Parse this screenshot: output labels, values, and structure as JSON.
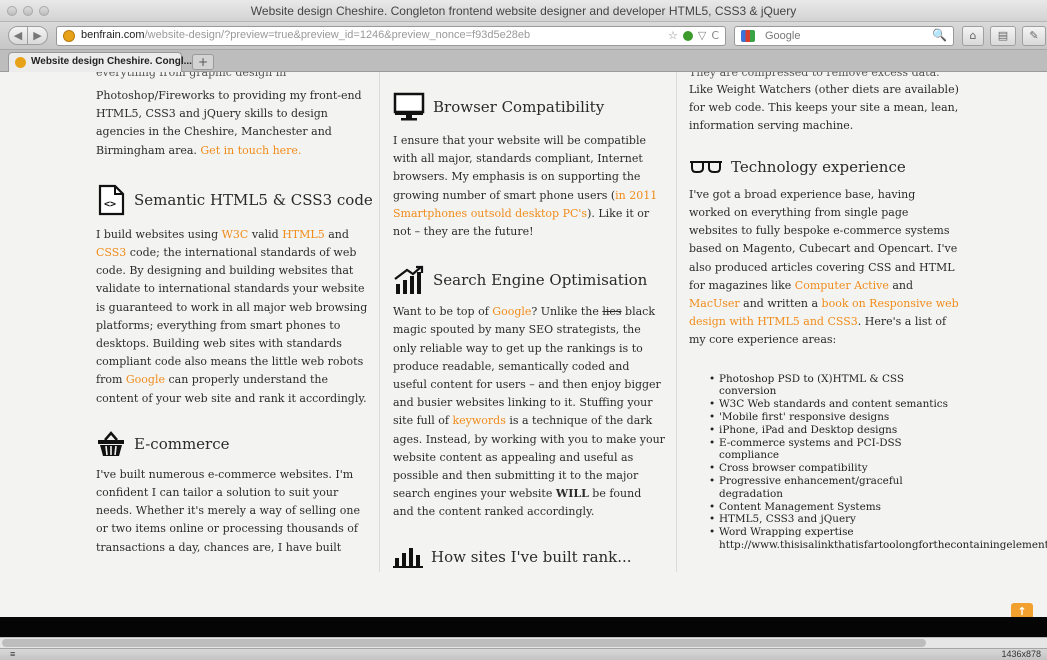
{
  "window": {
    "title": "Website design Cheshire. Congleton frontend website designer and developer HTML5, CSS3 & jQuery"
  },
  "nav": {
    "back_glyph": "◀",
    "forward_glyph": "▶",
    "url_domain": "benfrain.com",
    "url_rest": "/website-design/?preview=true&preview_id=1246&preview_nonce=f93d5e28eb",
    "url_star": "☆",
    "url_filter": "▽",
    "url_reload": "C",
    "search_placeholder": "Google",
    "search_glyph": "🔍",
    "home_glyph": "⌂",
    "bookmark_glyph": "▤",
    "more_glyph": "✎"
  },
  "tabs": [
    {
      "label": "Website design Cheshire. Congl..."
    }
  ],
  "new_tab_glyph": "+",
  "col1": {
    "cut_text": "everything from graphic design in",
    "intro": [
      {
        "t": "Photoshop/Fireworks to providing my front-end HTML5, CSS3 and jQuery skills to design agencies in the Cheshire, Manchester and Birmingham area. "
      },
      {
        "t": "Get in touch here.",
        "link": true
      }
    ],
    "semantic_heading": "Semantic HTML5 & CSS3 code",
    "semantic_body": [
      {
        "t": "I build websites using "
      },
      {
        "t": "W3C",
        "link": true
      },
      {
        "t": " valid "
      },
      {
        "t": "HTML5",
        "link": true
      },
      {
        "t": " and "
      },
      {
        "t": "CSS3",
        "link": true
      },
      {
        "t": " code; the international standards of web code. By designing and building websites that validate to international standards your website is guaranteed to work in all major web browsing platforms; everything from smart phones to desktops. Building web sites with standards compliant code also means the little web robots from "
      },
      {
        "t": "Google",
        "link": true
      },
      {
        "t": " can properly understand the content of your web site and rank it accordingly."
      }
    ],
    "ecom_heading": "E-commerce",
    "ecom_body": [
      {
        "t": "I've built numerous e-commerce websites. I'm confident I can tailor a solution to suit your needs. Whether it's merely a way of selling one or two items online or processing thousands of transactions a day, chances are, I have built"
      }
    ]
  },
  "col2": {
    "browser_heading": "Browser Compatibility",
    "browser_body": [
      {
        "t": "I ensure that your website will be compatible with all major, standards compliant, Internet browsers. My emphasis is on supporting the growing number of smart phone users ("
      },
      {
        "t": "in 2011 Smartphones outsold desktop PC's",
        "link": true
      },
      {
        "t": "). Like it or not – they are the future!"
      }
    ],
    "seo_heading": "Search Engine Optimisation",
    "seo_body": [
      {
        "t": "Want to be top of "
      },
      {
        "t": "Google",
        "link": true
      },
      {
        "t": "? Unlike the "
      },
      {
        "t": "lies",
        "strike": true
      },
      {
        "t": " black magic spouted by many SEO strategists, the only reliable way to get up the rankings is to produce readable, semantically coded and useful content for users – and then enjoy bigger and busier websites linking to it. Stuffing your site full of "
      },
      {
        "t": "keywords",
        "link": true
      },
      {
        "t": " is a technique of the dark ages. Instead, by working with you to make your website content as appealing and useful as possible and then submitting it to the major search engines your website "
      },
      {
        "t": "WILL",
        "bold": true
      },
      {
        "t": " be found and the content ranked accordingly."
      }
    ],
    "rank_heading": "How sites I've built rank..."
  },
  "col3": {
    "cut_text": "They are compressed to remove excess data.",
    "intro": [
      {
        "t": "Like Weight Watchers (other diets are available) for web code. This keeps your site a mean, lean, information serving machine."
      }
    ],
    "tech_heading": "Technology experience",
    "tech_body": [
      {
        "t": "I've got a broad experience base, having worked on everything from single page websites to fully bespoke e-commerce systems based on Magento, Cubecart and Opencart. I've also produced articles covering CSS and HTML for magazines like "
      },
      {
        "t": "Computer Active",
        "link": true
      },
      {
        "t": " and "
      },
      {
        "t": "MacUser",
        "link": true
      },
      {
        "t": " and written a "
      },
      {
        "t": "book on Responsive web design with HTML5 and CSS3",
        "link": true
      },
      {
        "t": ". Here's a list of my core experience areas:"
      }
    ],
    "list": [
      "Photoshop PSD to (X)HTML & CSS",
      "    conversion",
      "W3C Web standards and content semantics",
      "'Mobile first' responsive designs",
      "iPhone, iPad and Desktop designs",
      "E-commerce systems and PCI-DSS",
      "    compliance",
      "Cross browser compatibility",
      "Progressive enhancement/graceful",
      "    degradation",
      "Content Management Systems",
      "HTML5, CSS3 and jQuery",
      "Word Wrapping expertise",
      "    http://www.thisisalinkthatisfartoolongforthecontainingelement.com"
    ]
  },
  "top_button": "↑",
  "status": {
    "left": "≡",
    "right": "1436x878"
  }
}
